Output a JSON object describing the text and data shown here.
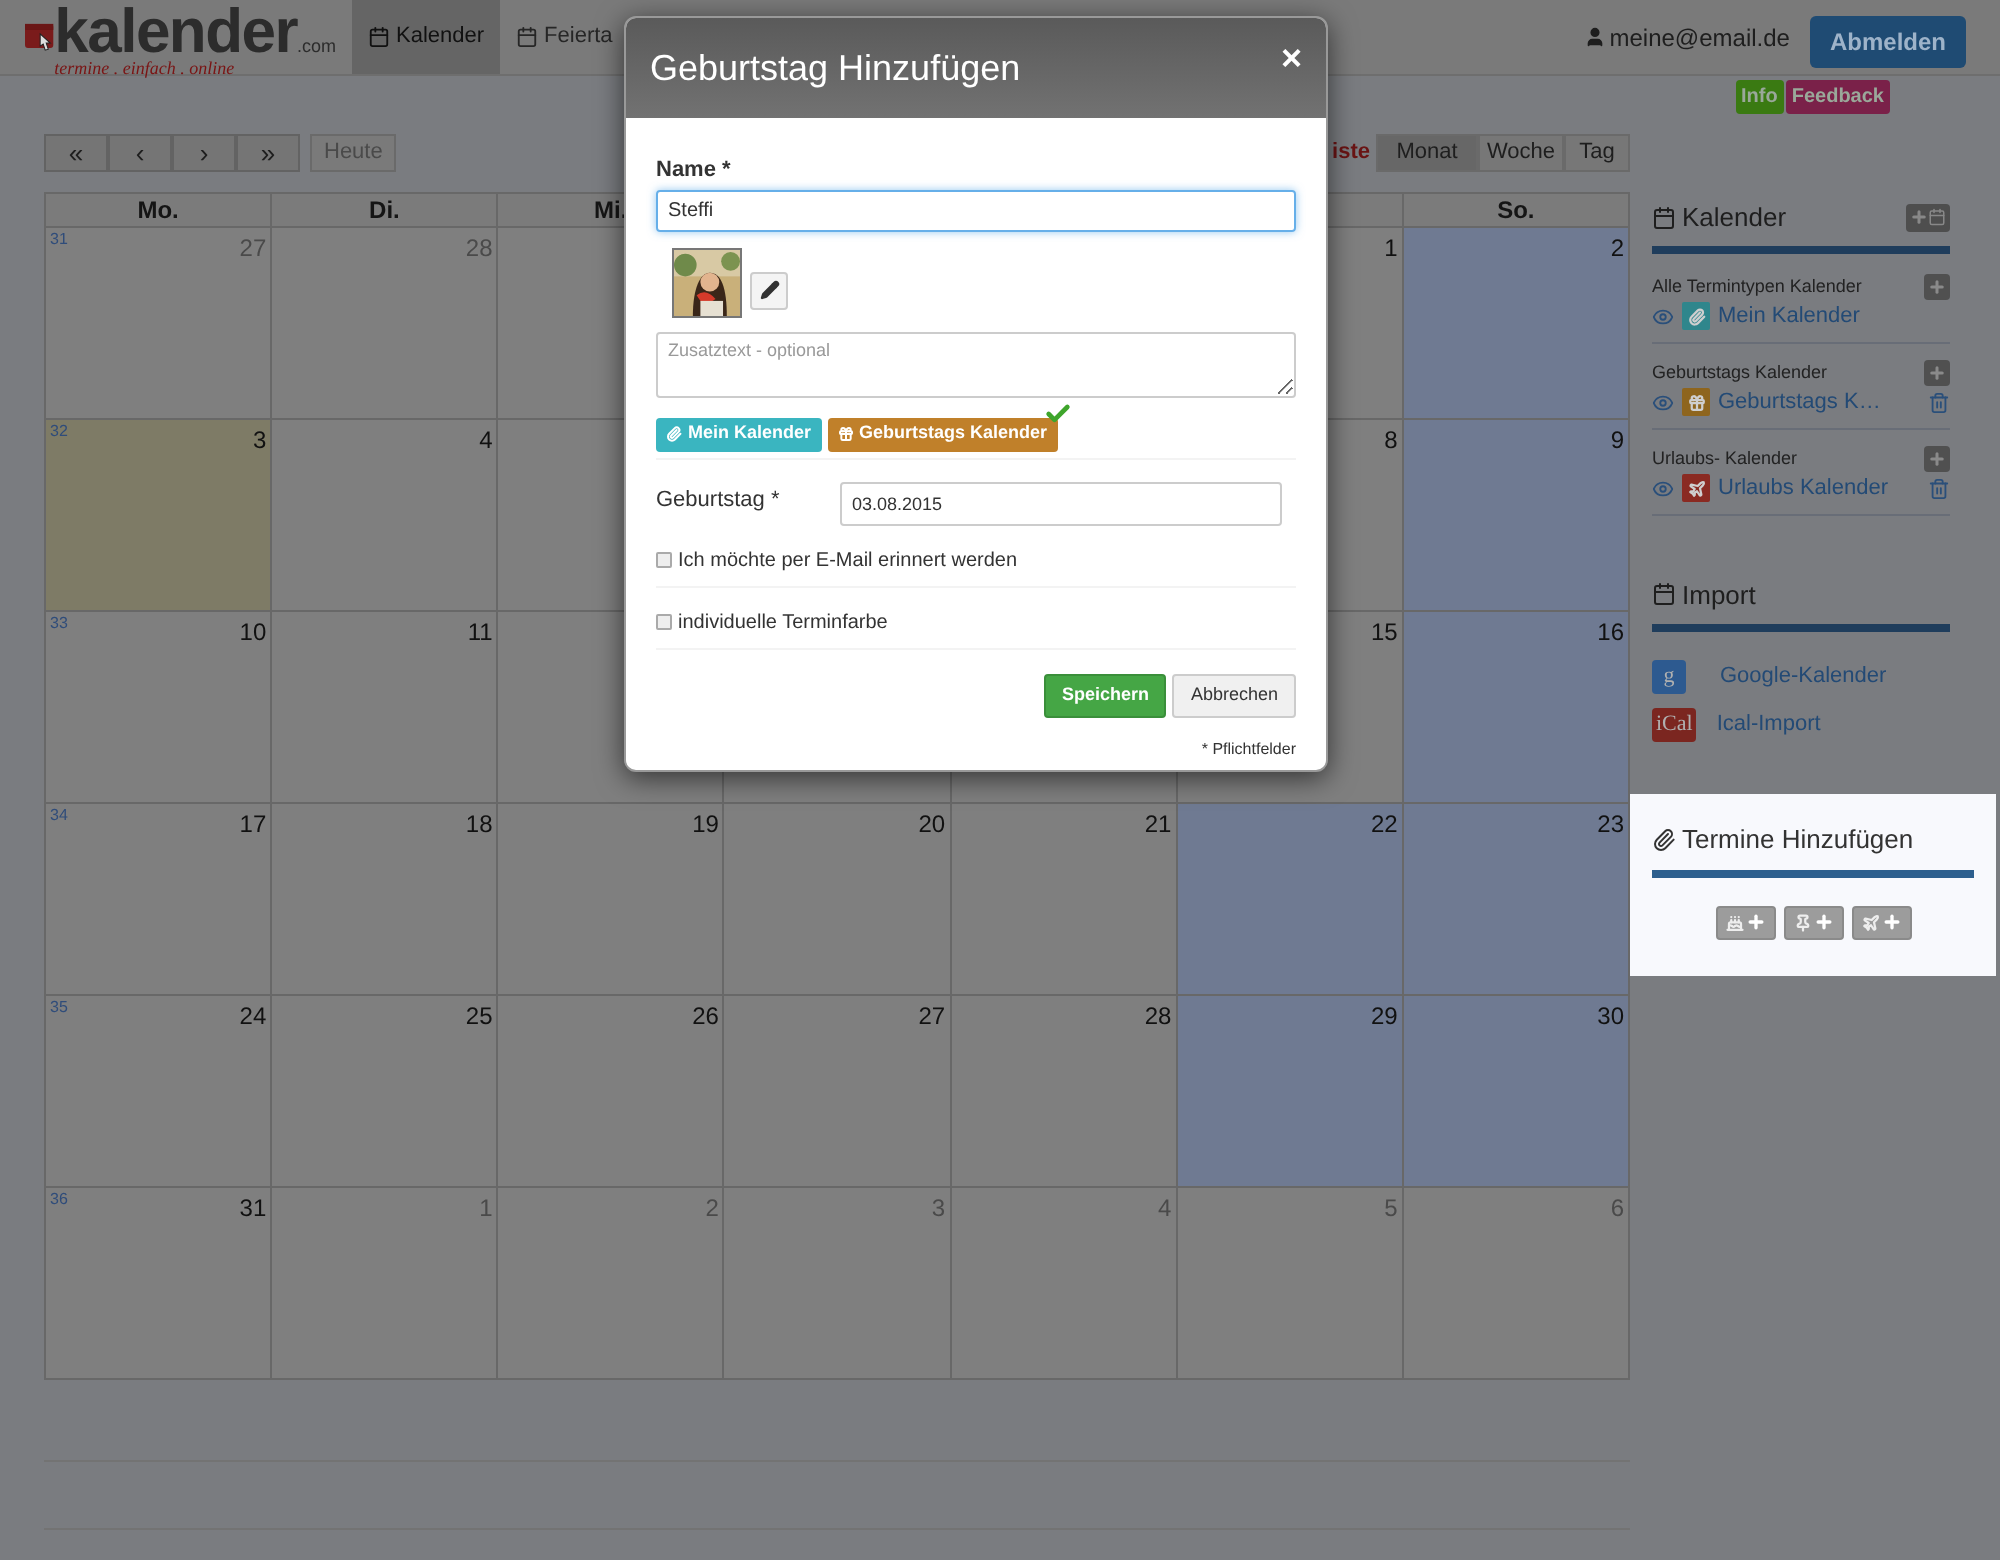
{
  "header": {
    "logo": {
      "name": "kalender",
      "domain": ".com",
      "tagline": "termine . einfach . online"
    },
    "nav": [
      {
        "label": "Kalender",
        "selected": true
      },
      {
        "label": "Feierta",
        "selected": false
      }
    ],
    "user": "meine@email.de",
    "logout": "Abmelden",
    "badges": [
      {
        "label": "Info",
        "color": "#3a7a12"
      },
      {
        "label": "Feedback",
        "color": "#7a2149"
      }
    ]
  },
  "toolbar": {
    "nav_buttons": [
      "«",
      "‹",
      "›",
      "»"
    ],
    "today": "Heute",
    "views": [
      {
        "label": "iste",
        "kind": "link",
        "selected": false
      },
      {
        "label": "Monat",
        "kind": "button",
        "selected": true
      },
      {
        "label": "Woche",
        "kind": "button",
        "selected": false
      },
      {
        "label": "Tag",
        "kind": "button",
        "selected": false
      }
    ]
  },
  "calendar": {
    "weekdays": {
      "mo": "Mo.",
      "di": "Di.",
      "mi": "Mi.",
      "so": "So."
    },
    "weeks": [
      {
        "week": "31",
        "days": [
          {
            "day": "27",
            "kind": "other"
          },
          {
            "day": "28",
            "kind": "other"
          },
          {
            "kind": "normal"
          },
          {
            "kind": "normal"
          },
          {
            "kind": "normal"
          },
          {
            "day": "1",
            "kind": "normal"
          },
          {
            "day": "2",
            "kind": "weekend"
          }
        ]
      },
      {
        "week": "32",
        "days": [
          {
            "day": "3",
            "kind": "today"
          },
          {
            "day": "4",
            "kind": "normal"
          },
          {
            "kind": "normal"
          },
          {
            "kind": "normal"
          },
          {
            "kind": "normal"
          },
          {
            "day": "8",
            "kind": "normal"
          },
          {
            "day": "9",
            "kind": "weekend"
          }
        ]
      },
      {
        "week": "33",
        "days": [
          {
            "day": "10",
            "kind": "normal"
          },
          {
            "day": "11",
            "kind": "normal"
          },
          {
            "kind": "normal"
          },
          {
            "kind": "normal"
          },
          {
            "kind": "normal"
          },
          {
            "day": "15",
            "kind": "normal"
          },
          {
            "day": "16",
            "kind": "weekend"
          }
        ]
      },
      {
        "week": "34",
        "days": [
          {
            "day": "17",
            "kind": "normal"
          },
          {
            "day": "18",
            "kind": "normal"
          },
          {
            "day": "19",
            "kind": "normal"
          },
          {
            "day": "20",
            "kind": "normal"
          },
          {
            "day": "21",
            "kind": "normal"
          },
          {
            "day": "22",
            "kind": "weekend"
          },
          {
            "day": "23",
            "kind": "weekend"
          }
        ]
      },
      {
        "week": "35",
        "days": [
          {
            "day": "24",
            "kind": "normal"
          },
          {
            "day": "25",
            "kind": "normal"
          },
          {
            "day": "26",
            "kind": "normal"
          },
          {
            "day": "27",
            "kind": "normal"
          },
          {
            "day": "28",
            "kind": "normal"
          },
          {
            "day": "29",
            "kind": "weekend"
          },
          {
            "day": "30",
            "kind": "weekend"
          }
        ]
      },
      {
        "week": "36",
        "days": [
          {
            "day": "31",
            "kind": "normal"
          },
          {
            "day": "1",
            "kind": "other"
          },
          {
            "day": "2",
            "kind": "other"
          },
          {
            "day": "3",
            "kind": "other"
          },
          {
            "day": "4",
            "kind": "other"
          },
          {
            "day": "5",
            "kind": "other"
          },
          {
            "day": "6",
            "kind": "other"
          }
        ]
      }
    ]
  },
  "sidebar": {
    "calendars": {
      "title": "Kalender",
      "groups": [
        {
          "label": "Alle Termintypen Kalender",
          "name": "Mein Kalender",
          "kind": "all",
          "color": "#2f868c",
          "deletable": false
        },
        {
          "label": "Geburtstags Kalender",
          "name": "Geburtstags K…",
          "kind": "birthday",
          "color": "#8e651e",
          "deletable": true
        },
        {
          "label": "Urlaubs- Kalender",
          "name": "Urlaubs Kalender",
          "kind": "vacation",
          "color": "#8a2a22",
          "deletable": true
        }
      ]
    },
    "import": {
      "title": "Import",
      "items": [
        {
          "icon": "g",
          "label": "Google-Kalender",
          "color": "#2d5a90"
        },
        {
          "icon": "iCal",
          "label": "Ical-Import",
          "color": "#7b2620"
        }
      ]
    },
    "add_events": {
      "title": "Termine Hinzufügen",
      "buttons": [
        {
          "kind": "birthday"
        },
        {
          "kind": "appointment"
        },
        {
          "kind": "vacation"
        }
      ]
    }
  },
  "dialog": {
    "title": "Geburtstag Hinzufügen",
    "close": "×",
    "name_label": "Name *",
    "name_value": "Steffi",
    "note_placeholder": "Zusatztext - optional",
    "calendars": [
      {
        "label": "Mein Kalender",
        "kind": "all",
        "color": "#3ab5c0",
        "selected": false
      },
      {
        "label": "Geburtstags Kalender",
        "kind": "birthday",
        "color": "#c0802a",
        "selected": true
      }
    ],
    "date_label": "Geburtstag *",
    "date_value": "03.08.2015",
    "options": [
      {
        "label": "Ich möchte per E-Mail erinnert werden",
        "checked": false
      },
      {
        "label": "individuelle Terminfarbe",
        "checked": false
      }
    ],
    "buttons": [
      {
        "label": "Speichern",
        "kind": "primary"
      },
      {
        "label": "Abbrechen",
        "kind": "default"
      }
    ],
    "footnote": "* Pflichtfelder"
  }
}
